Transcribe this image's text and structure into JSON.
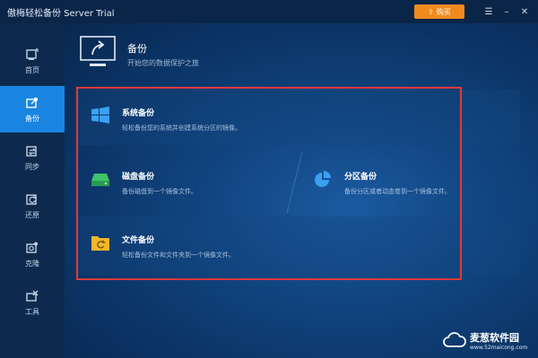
{
  "window": {
    "title": "傲梅轻松备份 Server Trial",
    "buy_label": "购买",
    "menu_icon": "menu-icon",
    "min_icon": "minimize-icon",
    "close_icon": "close-icon"
  },
  "sidebar": {
    "items": [
      {
        "label": "首页",
        "icon": "home-icon",
        "active": false
      },
      {
        "label": "备份",
        "icon": "backup-icon",
        "active": true
      },
      {
        "label": "同步",
        "icon": "sync-icon",
        "active": false
      },
      {
        "label": "还原",
        "icon": "restore-icon",
        "active": false
      },
      {
        "label": "克隆",
        "icon": "clone-icon",
        "active": false
      },
      {
        "label": "工具",
        "icon": "tools-icon",
        "active": false
      }
    ]
  },
  "header": {
    "title": "备份",
    "subtitle": "开始您的数据保护之旅"
  },
  "options": {
    "system": {
      "title": "系统备份",
      "desc": "轻松备份您的系统并创建系统分区的镜像。",
      "icon": "windows-icon"
    },
    "disk": {
      "title": "磁盘备份",
      "desc": "备份磁盘到一个镜像文件。",
      "icon": "disk-icon"
    },
    "partition": {
      "title": "分区备份",
      "desc": "备份分区或者动态卷到一个镜像文件。",
      "icon": "partition-icon"
    },
    "file": {
      "title": "文件备份",
      "desc": "轻松备份文件和文件夹到一个镜像文件。",
      "icon": "folder-icon"
    }
  },
  "watermark": {
    "brand": "麦葱软件园",
    "url": "www.52maicong.com"
  },
  "colors": {
    "accent": "#1a85e0",
    "buy": "#f08a1d",
    "highlight_frame": "#e23a3a",
    "disk_green": "#3fc46a",
    "folder_yellow": "#f4b62c",
    "windows_blue": "#3aa0f0"
  }
}
